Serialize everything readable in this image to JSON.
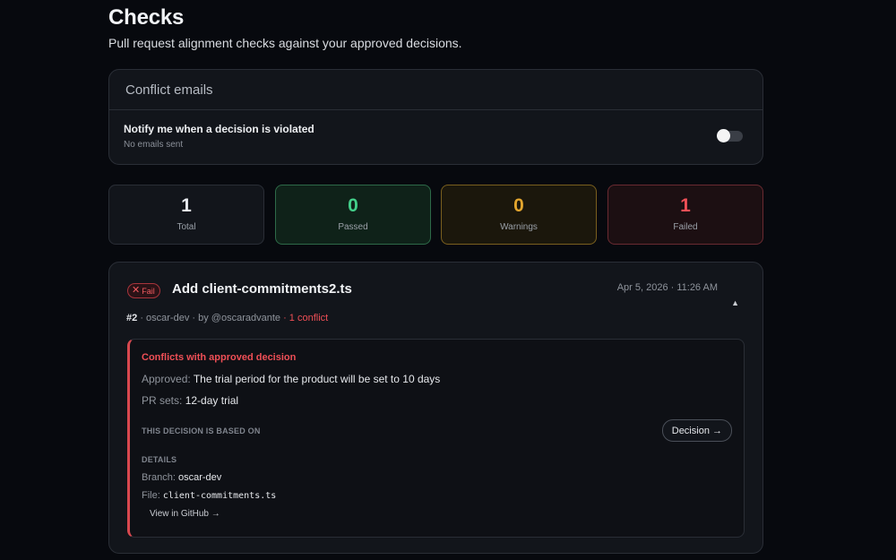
{
  "header": {
    "title": "Checks",
    "subtitle": "Pull request alignment checks against your approved decisions."
  },
  "email_settings": {
    "title": "Conflict emails",
    "notify_label": "Notify me when a decision is violated",
    "status": "No emails sent",
    "toggle_on": false
  },
  "stats": {
    "total": {
      "value": "1",
      "label": "Total"
    },
    "passed": {
      "value": "0",
      "label": "Passed"
    },
    "warnings": {
      "value": "0",
      "label": "Warnings"
    },
    "failed": {
      "value": "1",
      "label": "Failed"
    }
  },
  "check": {
    "status_badge": "Fail",
    "title": "Add client-commitments2.ts",
    "date": "Apr 5, 2026 · 11:26 AM",
    "pr_number": "#2",
    "branch_meta": "· oscar-dev",
    "author_meta": "· by @oscaradvante",
    "conflict_meta": "· 1 conflict",
    "conflict": {
      "title": "Conflicts with approved decision",
      "approved_key": "Approved:",
      "approved_value": "The trial period for the product will be set to 10 days",
      "prsets_key": "PR sets:",
      "prsets_value": "12-day trial",
      "based_on_label": "THIS DECISION IS BASED ON",
      "decision_button": "Decision →",
      "details_label": "DETAILS",
      "branch_key": "Branch:",
      "branch_value": "oscar-dev",
      "file_key": "File:",
      "file_value": "client-commitments.ts",
      "github_link": "View in GitHub →"
    }
  },
  "colors": {
    "background": "#07090e",
    "card": "#12151b",
    "passed": "#43d08a",
    "warning": "#e2a52e",
    "failed": "#ef4f56"
  },
  "icons": {
    "fail": "x-icon",
    "collapse": "chevron-up-icon"
  }
}
